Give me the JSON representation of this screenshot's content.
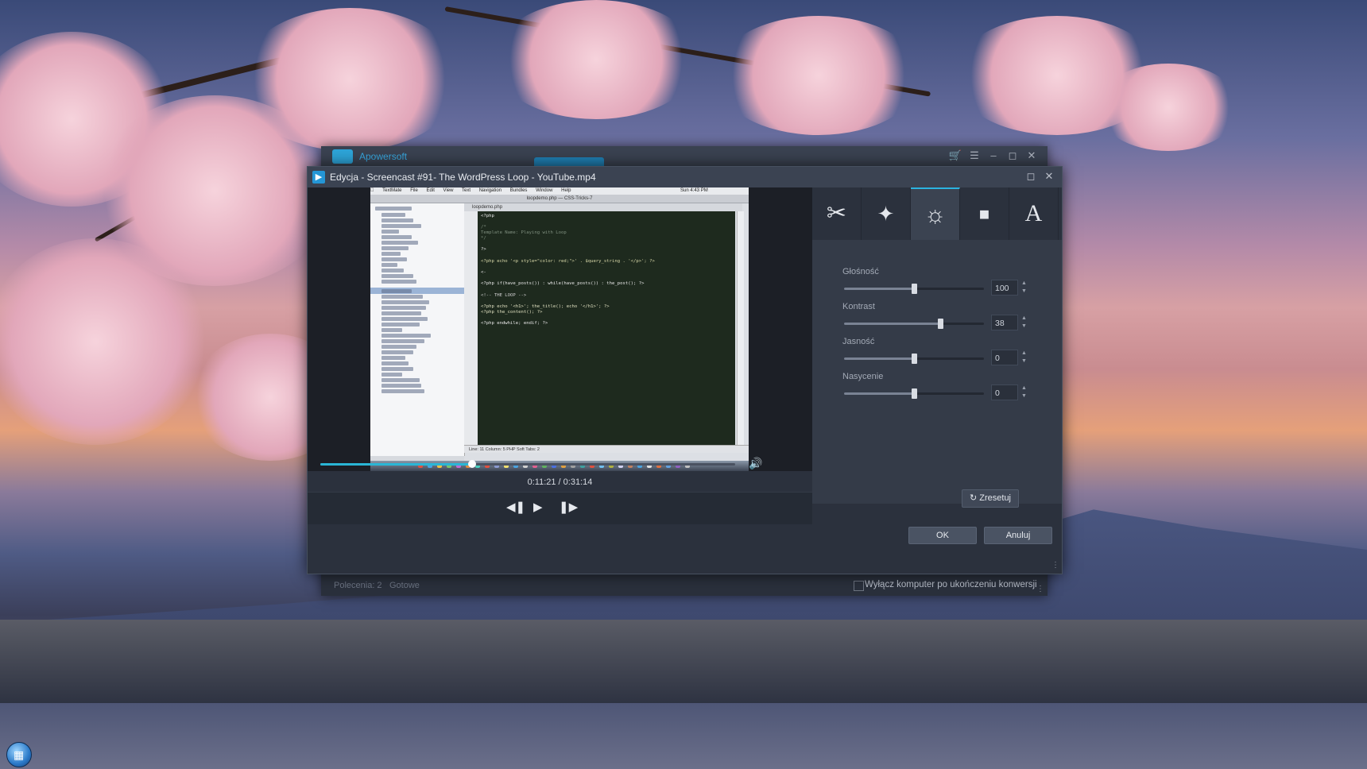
{
  "main_window": {
    "brand": "Apowersoft",
    "status_commands": "Polecenia: 2",
    "status_ready": "Gotowe",
    "shutdown_label": "Wyłącz komputer po ukończeniu konwersji"
  },
  "dialog": {
    "title": "Edycja - Screencast #91- The WordPress Loop - YouTube.mp4",
    "time": "0:11:21 / 0:31:14",
    "progress": 0.365,
    "ok_label": "OK",
    "cancel_label": "Anuluj",
    "reset_label": "Zresetuj",
    "params": [
      {
        "label": "Głośność",
        "value": "100",
        "position": 0.5
      },
      {
        "label": "Kontrast",
        "value": "38",
        "position": 0.69
      },
      {
        "label": "Jasność",
        "value": "0",
        "position": 0.5
      },
      {
        "label": "Nasycenie",
        "value": "0",
        "position": 0.5
      }
    ]
  },
  "video_frame": {
    "menubar": [
      "TextMate",
      "File",
      "Edit",
      "View",
      "Text",
      "Navigation",
      "Bundles",
      "Window",
      "Help"
    ],
    "clock": "Sun 4:43 PM",
    "window_title": "loopdemo.php — CSS-Tricks-7",
    "editor_tab": "loopdemo.php",
    "status_text": "Line: 11  Column: 5  PHP  Soft Tabs: 2",
    "code_lines": [
      "<?php",
      "/*",
      "   Template Name: Playing with Loop",
      "*/",
      "?>",
      "<?php echo '<p style=\"color: red;\">' . $query_string . '</p>'; ?>",
      "<-",
      "<?php if(have_posts()) : while(have_posts()) : the_post(); ?>",
      "  <!-- THE LOOP -->",
      "  <?php echo '<h1>'; the_title(); echo '</h1>'; ?>",
      "  <?php the_content(); ?>",
      "<?php endwhile; endif; ?>"
    ]
  }
}
